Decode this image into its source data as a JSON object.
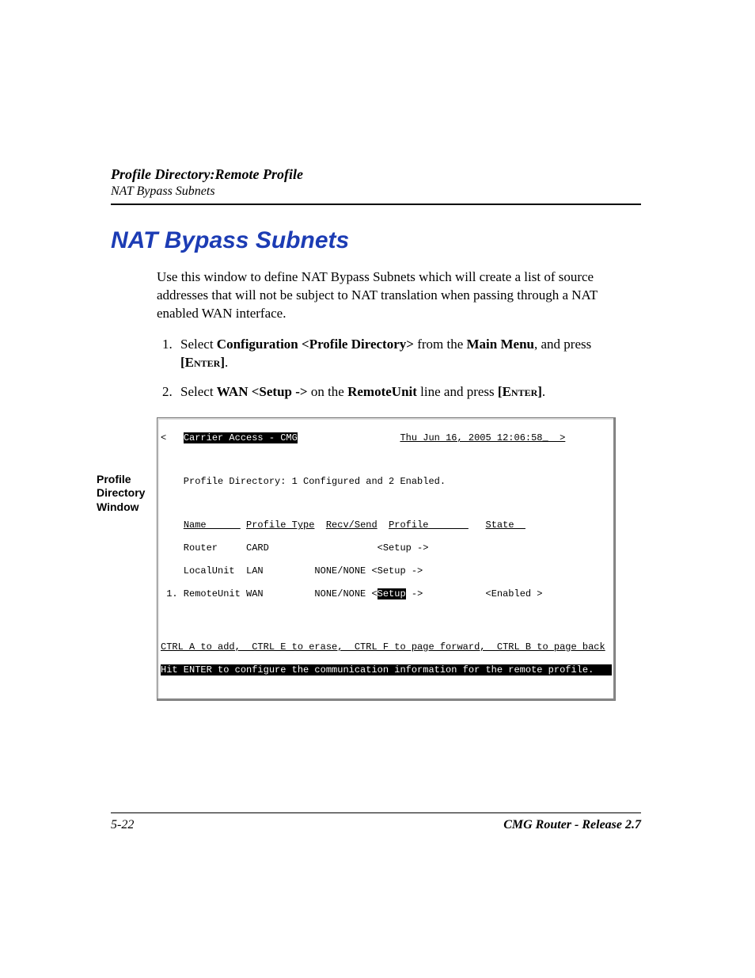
{
  "header": {
    "line1": "Profile Directory:Remote Profile",
    "line2": "NAT Bypass Subnets"
  },
  "title": "NAT Bypass Subnets",
  "intro": "Use this window to define NAT Bypass Subnets which will create a list of source addresses that will not be subject to NAT translation when passing through a NAT enabled WAN interface.",
  "steps": {
    "s1_a": "Select ",
    "s1_b": "Configuration <Profile Directory>",
    "s1_c": " from the ",
    "s1_d": "Main Menu",
    "s1_e": ", and press ",
    "s1_f": "[E",
    "s1_g": "nter",
    "s1_h": "]",
    "s1_i": ".",
    "s2_a": "Select ",
    "s2_b": "WAN <Setup ->",
    "s2_c": " on the ",
    "s2_d": "RemoteUnit",
    "s2_e": " line and press ",
    "s2_f": "[E",
    "s2_g": "nter",
    "s2_h": "]",
    "s2_i": "."
  },
  "figure_caption": "Profile Directory Window",
  "terminal": {
    "top_left_angle": "<   ",
    "top_title": "Carrier Access - CMG",
    "top_date": "Thu Jun 16, 2005 12:06:58_  >",
    "status_line": "    Profile Directory: 1 Configured and 2 Enabled.",
    "hdr_name": "Name      ",
    "hdr_ptype": "Profile Type",
    "hdr_recv": "Recv/Send",
    "hdr_profile": "Profile       ",
    "hdr_state": "State  ",
    "row1": "    Router     CARD                   <Setup ->",
    "row2": "    LocalUnit  LAN         NONE/NONE <Setup ->",
    "row3_a": " 1. RemoteUnit WAN         NONE/NONE <",
    "row3_setup": "Setup",
    "row3_b": " ->           <Enabled >",
    "ctrl_line": "CTRL A to add,  CTRL E to erase,  CTRL F to page forward,  CTRL B to page back",
    "hint_line": "Hit ENTER to configure the communication information for the remote profile. "
  },
  "footer": {
    "page": "5-22",
    "product": "CMG Router - Release 2.7"
  }
}
